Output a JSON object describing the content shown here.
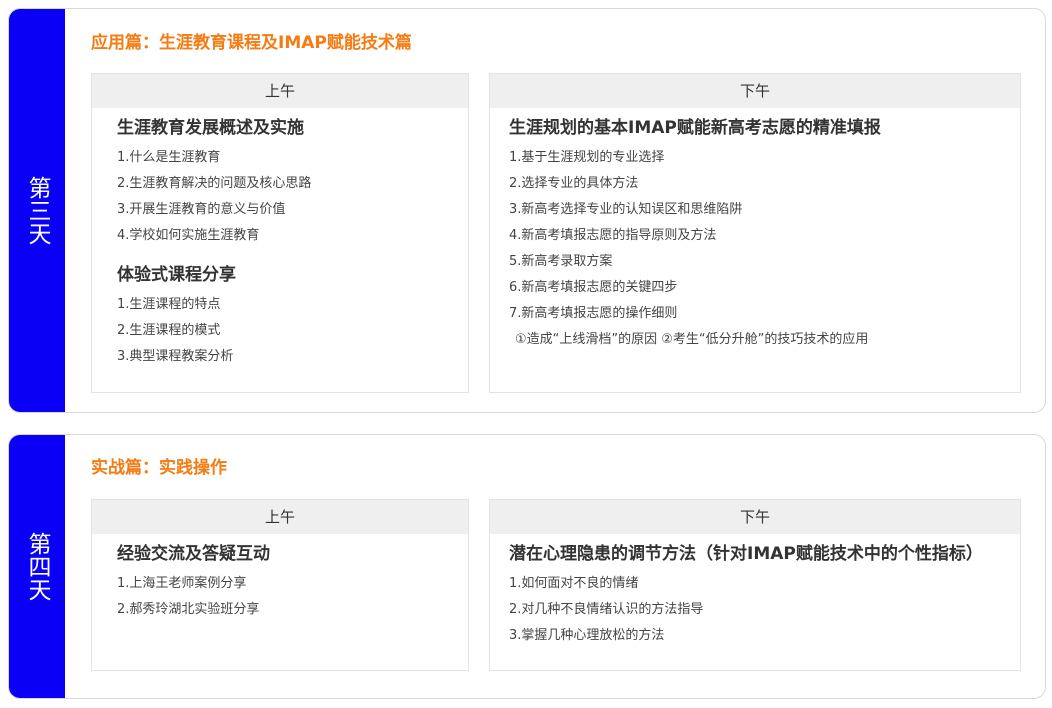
{
  "days": [
    {
      "tab": "第三天",
      "section_title": "应用篇：生涯教育课程及IMAP赋能技术篇",
      "am": {
        "label": "上午",
        "topics": [
          {
            "title": "生涯教育发展概述及实施",
            "items": [
              "1.什么是生涯教育",
              "2.生涯教育解决的问题及核心思路",
              "3.开展生涯教育的意义与价值",
              "4.学校如何实施生涯教育"
            ]
          },
          {
            "title": "体验式课程分享",
            "items": [
              "1.生涯课程的特点",
              "2.生涯课程的模式",
              "3.典型课程教案分析"
            ]
          }
        ]
      },
      "pm": {
        "label": "下午",
        "topics": [
          {
            "title": "生涯规划的基本IMAP赋能新高考志愿的精准填报",
            "items": [
              "1.基于生涯规划的专业选择",
              "2.选择专业的具体方法",
              "3.新高考选择专业的认知误区和思维陷阱",
              "4.新高考填报志愿的指导原则及方法",
              "5.新高考录取方案",
              "6.新高考填报志愿的关键四步",
              "7.新高考填报志愿的操作细则"
            ],
            "sub": "①造成“上线滑档”的原因  ②考生“低分升舱”的技巧技术的应用"
          }
        ]
      }
    },
    {
      "tab": "第四天",
      "section_title": "实战篇：实践操作",
      "am": {
        "label": "上午",
        "topics": [
          {
            "title": "经验交流及答疑互动",
            "items": [
              "1.上海王老师案例分享",
              "2.郝秀玲湖北实验班分享"
            ]
          }
        ]
      },
      "pm": {
        "label": "下午",
        "topics": [
          {
            "title": "潜在心理隐患的调节方法（针对IMAP赋能技术中的个性指标）",
            "items": [
              "1.如何面对不良的情绪",
              "2.对几种不良情绪认识的方法指导",
              "3.掌握几种心理放松的方法"
            ]
          }
        ]
      }
    }
  ],
  "colors": {
    "tab_blue": "#0a00f5",
    "section_orange": "#f57c14",
    "slot_header_gray": "#efefef"
  }
}
